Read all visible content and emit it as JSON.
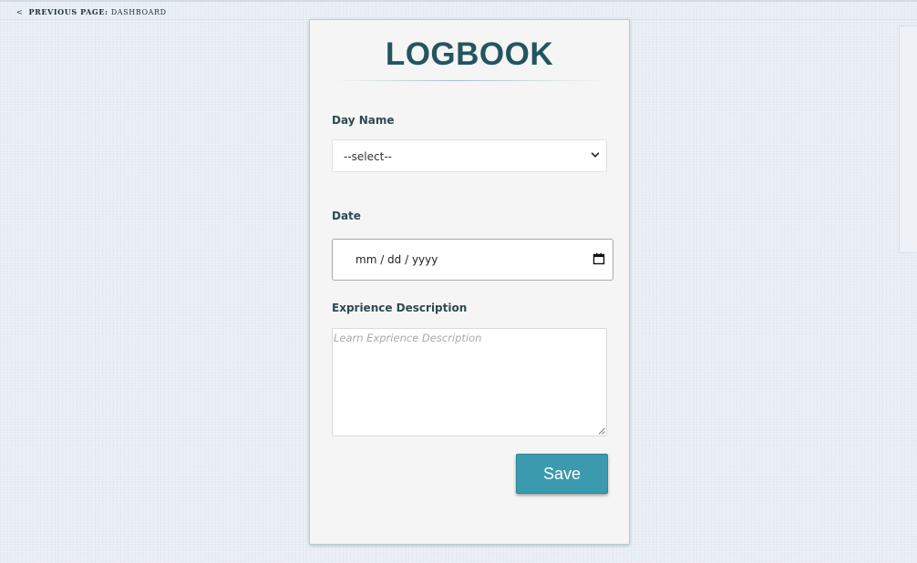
{
  "breadcrumb": {
    "arrow": "<",
    "prefix": "PREVIOUS PAGE:",
    "page": "DASHBOARD"
  },
  "form": {
    "title": "LOGBOOK",
    "day_name": {
      "label": "Day Name",
      "selected": "--select--"
    },
    "date": {
      "label": "Date",
      "value": "mm / dd / yyyy"
    },
    "description": {
      "label": "Exprience Description",
      "placeholder": "Learn Exprience Description"
    },
    "save_label": "Save"
  },
  "colors": {
    "accent": "#3b9aad",
    "title": "#23555f",
    "label": "#2e4a52",
    "card_background": "#f5f5f5",
    "page_background": "#e9eef5"
  },
  "icons": {
    "select": "chevron-down-icon",
    "date": "calendar-icon",
    "textarea": "resize-grip-icon"
  }
}
